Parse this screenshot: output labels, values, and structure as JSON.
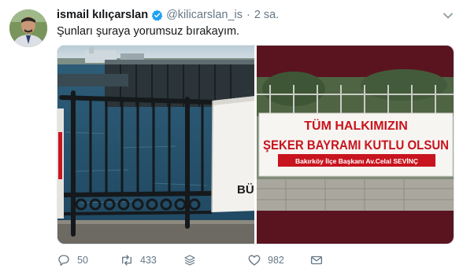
{
  "author": {
    "name": "ismail kılıçarslan",
    "handle": "@kilicarslan_is",
    "time": "2 sa.",
    "separator": "·"
  },
  "tweet": {
    "text": "Şunları şuraya yorumsuz bırakayım."
  },
  "media": {
    "left_photo_partial_sign_text": "BÜ",
    "banner": {
      "line1": "TÜM HALKIMIZIN",
      "line2": "ŞEKER BAYRAMI KUTLU OLSUN",
      "signature": "Bakırköy İlçe Başkanı Av.Celal SEVİNÇ"
    }
  },
  "actions": {
    "reply_count": "50",
    "retweet_count": "433",
    "like_count": "982"
  },
  "colors": {
    "verified": "#1da1f2",
    "banner_red": "#c8141e",
    "divider_maroon": "#5a1420",
    "icon_gray": "#657786"
  },
  "icons": [
    "verified-badge-icon",
    "chevron-down-icon",
    "reply-icon",
    "retweet-icon",
    "stack-icon",
    "heart-icon",
    "mail-icon"
  ]
}
